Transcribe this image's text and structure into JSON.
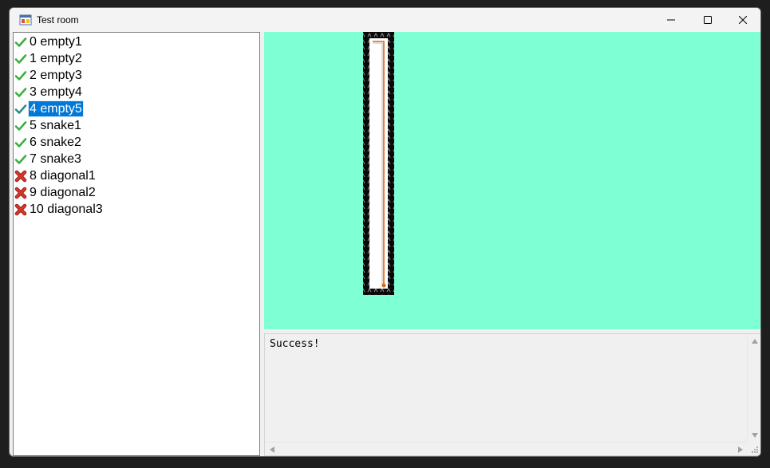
{
  "window": {
    "title": "Test room",
    "icon": "app-window-icon",
    "controls": {
      "minimize_icon": "minimize-icon",
      "maximize_icon": "maximize-icon",
      "close_icon": "close-icon"
    }
  },
  "test_list": {
    "selected_index": 4,
    "items": [
      {
        "label": "0 empty1",
        "status": "pass"
      },
      {
        "label": "1 empty2",
        "status": "pass"
      },
      {
        "label": "2 empty3",
        "status": "pass"
      },
      {
        "label": "3 empty4",
        "status": "pass"
      },
      {
        "label": "4 empty5",
        "status": "pass"
      },
      {
        "label": "5 snake1",
        "status": "pass"
      },
      {
        "label": "6 snake2",
        "status": "pass"
      },
      {
        "label": "7 snake3",
        "status": "pass"
      },
      {
        "label": "8 diagonal1",
        "status": "fail"
      },
      {
        "label": "9 diagonal2",
        "status": "fail"
      },
      {
        "label": "10 diagonal3",
        "status": "fail"
      }
    ]
  },
  "room_view": {
    "background_color": "#7fffd4",
    "wall_color": "#0a0a0a",
    "path_color": "#d2691e"
  },
  "console": {
    "output": "Success!"
  },
  "colors": {
    "pass_icon": "#3cb043",
    "fail_icon": "#d9342b",
    "selection": "#0078d7"
  }
}
